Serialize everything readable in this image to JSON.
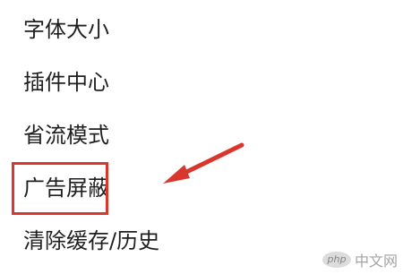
{
  "menu": {
    "items": [
      {
        "label": "字体大小"
      },
      {
        "label": "插件中心"
      },
      {
        "label": "省流模式"
      },
      {
        "label": "广告屏蔽"
      },
      {
        "label": "清除缓存/历史"
      }
    ]
  },
  "annotation": {
    "highlight_color": "#d9362d",
    "highlighted_item": "广告屏蔽"
  },
  "watermark": {
    "logo_text": "php",
    "site_text": "中文网"
  }
}
